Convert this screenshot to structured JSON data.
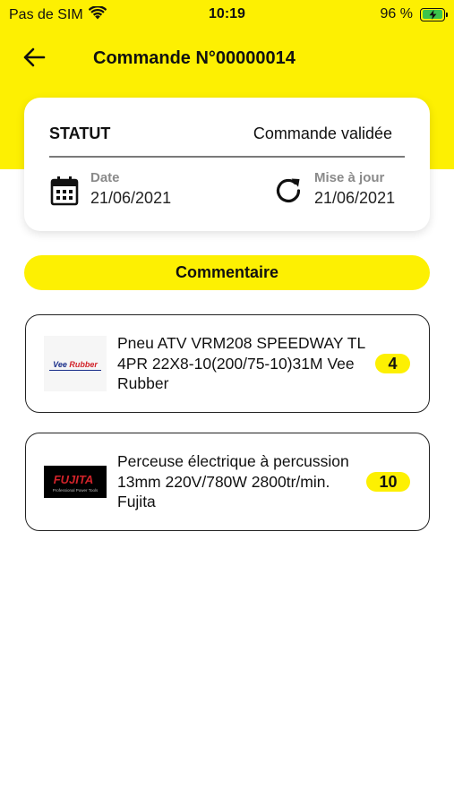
{
  "status_bar": {
    "carrier": "Pas de SIM",
    "time": "10:19",
    "battery": "96 %",
    "battery_level": 0.96
  },
  "header": {
    "title": "Commande N°00000014",
    "back_icon": "arrow-left-icon"
  },
  "status_card": {
    "statut_label": "STATUT",
    "statut_value": "Commande validée",
    "date_label": "Date",
    "date_value": "21/06/2021",
    "update_label": "Mise à jour",
    "update_value": "21/06/2021"
  },
  "comment_button": "Commentaire",
  "products": [
    {
      "name": "Pneu ATV VRM208 SPEEDWAY TL 4PR 22X8-10(200/75-10)31M Vee Rubber",
      "quantity": "4",
      "logo": {
        "brand": "Vee Rubber"
      }
    },
    {
      "name": "Perceuse électrique à percussion 13mm 220V/780W 2800tr/min. Fujita",
      "quantity": "10",
      "logo": {
        "brand": "FUJITA",
        "tagline": "Professional Power Tools"
      }
    }
  ],
  "colors": {
    "accent_yellow": "#fdf002",
    "battery_green": "#3cc34b"
  }
}
